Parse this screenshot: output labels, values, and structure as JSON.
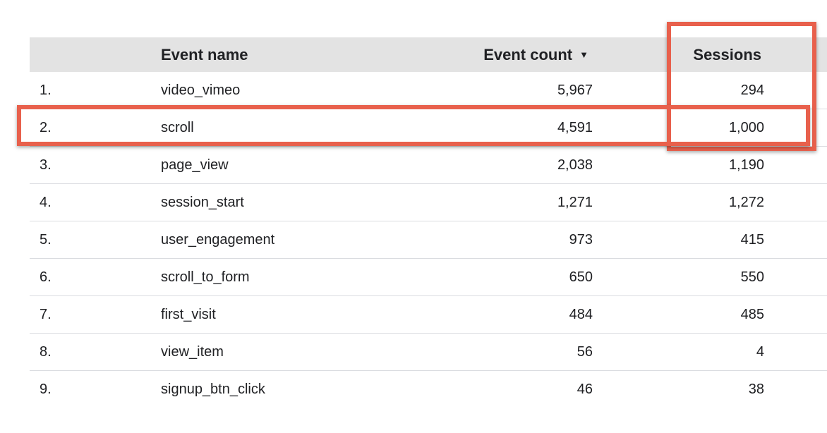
{
  "table": {
    "columns": {
      "event_name": "Event name",
      "event_count": "Event count",
      "sessions": "Sessions"
    },
    "sort": {
      "column": "event_count",
      "direction": "descending",
      "icon": "sort-descending-icon",
      "glyph": "▼"
    },
    "rows": [
      {
        "index": "1.",
        "event_name": "video_vimeo",
        "event_count": "5,967",
        "sessions": "294"
      },
      {
        "index": "2.",
        "event_name": "scroll",
        "event_count": "4,591",
        "sessions": "1,000"
      },
      {
        "index": "3.",
        "event_name": "page_view",
        "event_count": "2,038",
        "sessions": "1,190"
      },
      {
        "index": "4.",
        "event_name": "session_start",
        "event_count": "1,271",
        "sessions": "1,272"
      },
      {
        "index": "5.",
        "event_name": "user_engagement",
        "event_count": "973",
        "sessions": "415"
      },
      {
        "index": "6.",
        "event_name": "scroll_to_form",
        "event_count": "650",
        "sessions": "550"
      },
      {
        "index": "7.",
        "event_name": "first_visit",
        "event_count": "484",
        "sessions": "485"
      },
      {
        "index": "8.",
        "event_name": "view_item",
        "event_count": "56",
        "sessions": "4"
      },
      {
        "index": "9.",
        "event_name": "signup_btn_click",
        "event_count": "46",
        "sessions": "38"
      }
    ]
  },
  "annotations": {
    "highlight_color": "#e8604c",
    "highlighted_column": "sessions",
    "highlighted_row": "2."
  },
  "colors": {
    "header_background": "#e3e3e3",
    "row_divider": "#dadce0",
    "text": "#202124"
  }
}
